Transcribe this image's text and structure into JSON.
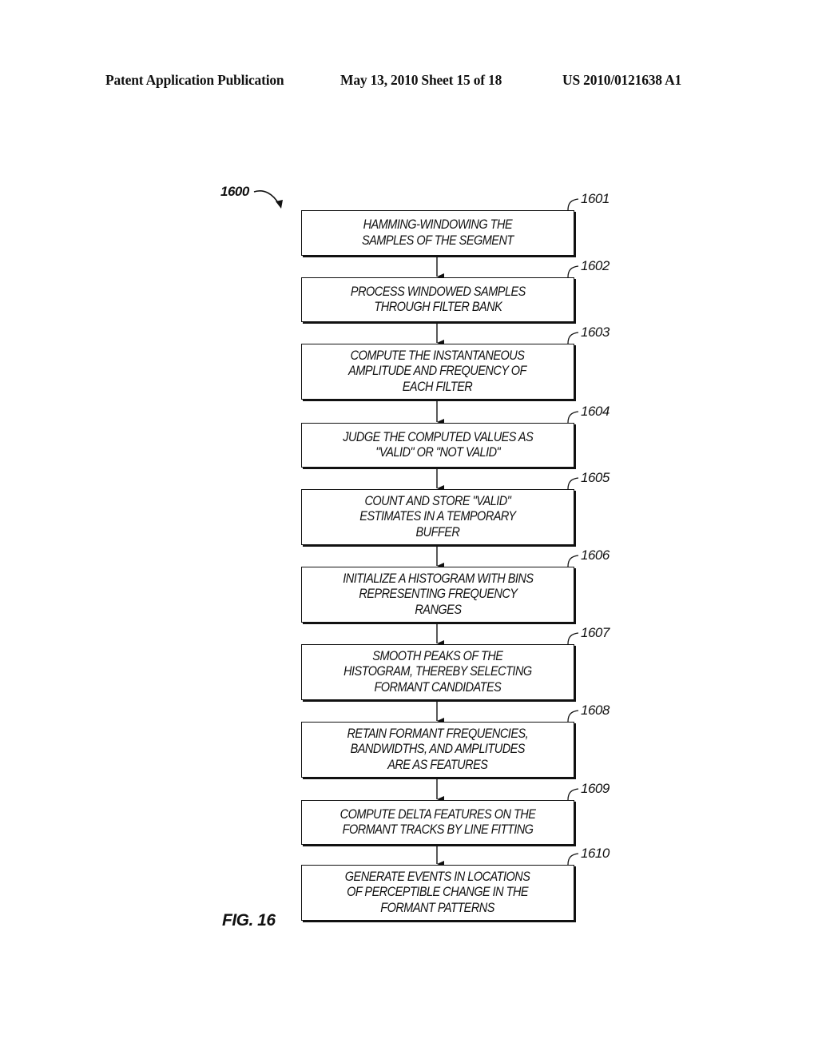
{
  "header": {
    "publication": "Patent Application Publication",
    "date_sheet": "May 13, 2010  Sheet 15 of 18",
    "number": "US 2010/0121638 A1"
  },
  "figure": {
    "ref": "1600",
    "label": "FIG. 16"
  },
  "steps": [
    {
      "ref": "1601",
      "text": "HAMMING-WINDOWING THE\nSAMPLES OF THE SEGMENT"
    },
    {
      "ref": "1602",
      "text": "PROCESS WINDOWED SAMPLES\nTHROUGH FILTER BANK"
    },
    {
      "ref": "1603",
      "text": "COMPUTE THE INSTANTANEOUS\nAMPLITUDE AND FREQUENCY OF\nEACH FILTER"
    },
    {
      "ref": "1604",
      "text": "JUDGE THE COMPUTED VALUES AS\n\"VALID\" OR \"NOT VALID\""
    },
    {
      "ref": "1605",
      "text": "COUNT AND STORE \"VALID\"\nESTIMATES IN A TEMPORARY\nBUFFER"
    },
    {
      "ref": "1606",
      "text": "INITIALIZE A HISTOGRAM WITH BINS\nREPRESENTING FREQUENCY\nRANGES"
    },
    {
      "ref": "1607",
      "text": "SMOOTH PEAKS OF THE\nHISTOGRAM, THEREBY SELECTING\nFORMANT CANDIDATES"
    },
    {
      "ref": "1608",
      "text": "RETAIN FORMANT FREQUENCIES,\nBANDWIDTHS, AND AMPLITUDES\nARE AS FEATURES"
    },
    {
      "ref": "1609",
      "text": "COMPUTE DELTA FEATURES ON THE\nFORMANT TRACKS BY LINE FITTING"
    },
    {
      "ref": "1610",
      "text": "GENERATE EVENTS IN LOCATIONS\nOF PERCEPTIBLE CHANGE IN THE\nFORMANT PATTERNS"
    }
  ]
}
